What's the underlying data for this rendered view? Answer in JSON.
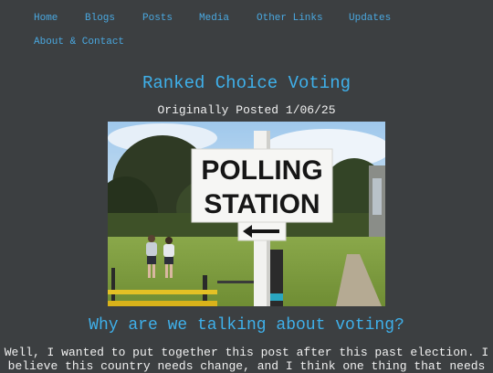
{
  "nav": {
    "home": "Home",
    "blogs": "Blogs",
    "posts": "Posts",
    "media": "Media",
    "other_links": "Other Links",
    "updates": "Updates",
    "about_contact": "About & Contact"
  },
  "post": {
    "title": "Ranked Choice Voting",
    "posted": "Originally Posted 1/06/25",
    "image": {
      "sign_line1": "POLLING",
      "sign_line2": "STATION"
    },
    "section_heading": "Why are we talking about voting?",
    "paragraph_line1": "Well, I wanted to put together this post after this past election. I",
    "paragraph_line2": "believe this country needs change, and I think one thing that needs"
  },
  "colors": {
    "background": "#3c3f41",
    "link": "#4aa8e0",
    "heading": "#3fb0ea",
    "text": "#f0f0f0"
  }
}
